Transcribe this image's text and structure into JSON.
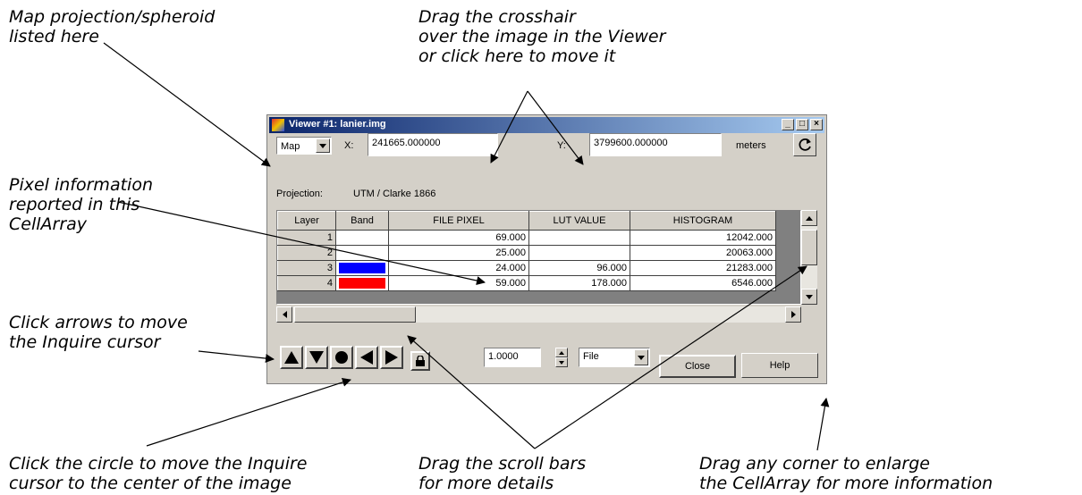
{
  "callouts": {
    "map_projection": "Map projection/spheroid\nlisted here",
    "crosshair": "Drag the crosshair\nover the image in the Viewer\nor click here to move it",
    "pixel_info": "Pixel information\nreported in this\nCellArray",
    "arrows": "Click arrows to move\nthe Inquire cursor",
    "circle": "Click the circle to move the Inquire\ncursor to the center of the image",
    "scroll": "Drag the scroll bars\nfor more details",
    "corner": "Drag any corner to enlarge\nthe CellArray for more information"
  },
  "window": {
    "title": "Viewer #1:  lanier.img",
    "coord_type": "Map",
    "x_label": "X:",
    "x_value": "241665.000000",
    "y_label": "Y:",
    "y_value": "3799600.000000",
    "units": "meters",
    "projection_label": "Projection:",
    "projection_value": "UTM / Clarke 1866",
    "table": {
      "columns": [
        "Layer",
        "Band",
        "FILE PIXEL",
        "LUT VALUE",
        "HISTOGRAM"
      ],
      "rows": [
        {
          "layer": "1",
          "band_color": "#ffffff",
          "file_pixel": "69.000",
          "lut_value": "",
          "histogram": "12042.000"
        },
        {
          "layer": "2",
          "band_color": "#ffffff",
          "file_pixel": "25.000",
          "lut_value": "",
          "histogram": "20063.000"
        },
        {
          "layer": "3",
          "band_color": "#0000ff",
          "file_pixel": "24.000",
          "lut_value": "96.000",
          "histogram": "21283.000"
        },
        {
          "layer": "4",
          "band_color": "#ff0000",
          "file_pixel": "59.000",
          "lut_value": "178.000",
          "histogram": "6546.000"
        }
      ]
    },
    "increment_value": "1.0000",
    "coord_space": "File",
    "close_label": "Close",
    "help_label": "Help"
  }
}
